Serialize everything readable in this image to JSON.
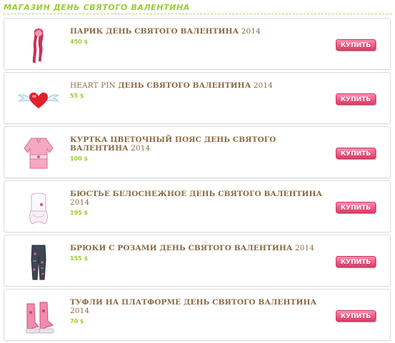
{
  "shop": {
    "title": "МАГАЗИН ДЕНЬ СВЯТОГО ВАЛЕНТИНА"
  },
  "buy_label": "КУПИТЬ",
  "items": [
    {
      "name": "ПАРИК ДЕНЬ СВЯТОГО ВАЛЕНТИНА",
      "year": "2014",
      "price": "450 $",
      "icon": "pink-wig-icon"
    },
    {
      "name_normal": "HEART PIN",
      "name": "ДЕНЬ СВЯТОГО ВАЛЕНТИНА",
      "year": "2014",
      "price": "55 $",
      "icon": "winged-heart-pin-icon"
    },
    {
      "name": "КУРТКА ЦВЕТОЧНЫЙ ПОЯС ДЕНЬ СВЯТОГО ВАЛЕНТИНА",
      "year": "2014",
      "price": "100 $",
      "icon": "pink-jacket-icon"
    },
    {
      "name": "БЮСТЬЕ БЕЛОСНЕЖНОЕ ДЕНЬ СВЯТОГО ВАЛЕНТИНА",
      "year": "2014",
      "price": "195 $",
      "icon": "white-bustier-icon"
    },
    {
      "name": "БРЮКИ С РОЗАМИ ДЕНЬ СВЯТОГО ВАЛЕНТИНА",
      "year": "2014",
      "price": "155 $",
      "icon": "rose-pants-icon"
    },
    {
      "name": "ТУФЛИ НА ПЛАТФОРМЕ ДЕНЬ СВЯТОГО ВАЛЕНТИНА",
      "year": "2014",
      "price": "70 $",
      "icon": "platform-shoes-icon"
    }
  ],
  "colors": {
    "accent_green": "#9acd32",
    "name_brown": "#8b6b45",
    "buy_pink": "#f25b86"
  }
}
